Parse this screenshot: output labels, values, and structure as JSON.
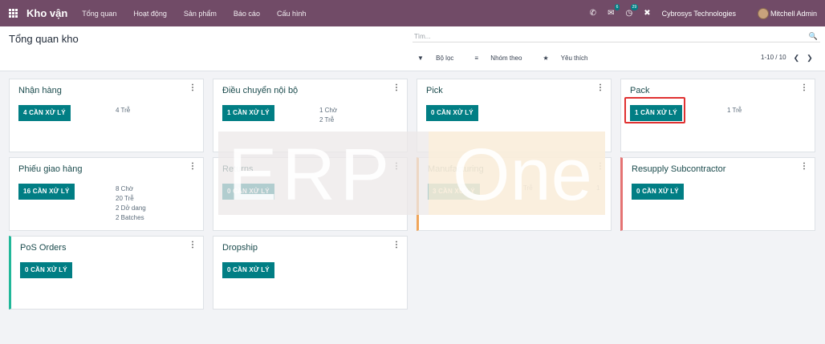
{
  "navbar": {
    "brand": "Kho vận",
    "menu": [
      "Tổng quan",
      "Hoạt động",
      "Sản phẩm",
      "Báo cáo",
      "Cấu hình"
    ],
    "icons": [
      "phone-icon",
      "chat-icon",
      "activity-icon",
      "tools-icon"
    ],
    "chat_badge": "6",
    "activity_badge": "29",
    "company": "Cybrosys Technologies",
    "user": "Mitchell Admin"
  },
  "control": {
    "title": "Tổng quan kho",
    "search_placeholder": "Tìm...",
    "filter_label": "Bộ lọc",
    "group_label": "Nhóm theo",
    "favorite_label": "Yêu thích",
    "pager": "1-10 / 10"
  },
  "watermark": {
    "left": "ERP",
    "right": "One"
  },
  "cards": [
    {
      "title": "Nhận hàng",
      "button": "4 CẦN XỬ LÝ",
      "stats": [
        "4 Trễ"
      ]
    },
    {
      "title": "Điều chuyển nội bộ",
      "button": "1 CẦN XỬ LÝ",
      "stats": [
        "1 Chờ",
        "2 Trễ"
      ]
    },
    {
      "title": "Pick",
      "button": "0 CẦN XỬ LÝ",
      "stats": []
    },
    {
      "title": "Pack",
      "button": "1 CẦN XỬ LÝ",
      "stats": [
        "1 Trễ"
      ]
    },
    {
      "title": "Phiếu giao hàng",
      "button": "16 CẦN XỬ LÝ",
      "stats": [
        "8 Chờ",
        "20 Trễ",
        "2 Dở dang",
        "2 Batches"
      ]
    },
    {
      "title": "Returns",
      "button": "0 CẦN XỬ LÝ",
      "stats": []
    },
    {
      "title": "Manufacturing",
      "button": "3 CẦN XỬ LÝ",
      "stats_label": "Trễ",
      "stats_value": "1"
    },
    {
      "title": "Resupply Subcontractor",
      "button": "0 CẦN XỬ LÝ",
      "stats": []
    },
    {
      "title": "PoS Orders",
      "button": "0 CẦN XỬ LÝ",
      "stats": []
    },
    {
      "title": "Dropship",
      "button": "0 CẦN XỬ LÝ",
      "stats": []
    }
  ],
  "colors": {
    "navbar": "#714b67",
    "button": "#017e84",
    "manufacturing_accent": "#f0a55a",
    "resupply_accent": "#e57373",
    "pos_accent": "#21b799",
    "highlight": "#e03131"
  }
}
